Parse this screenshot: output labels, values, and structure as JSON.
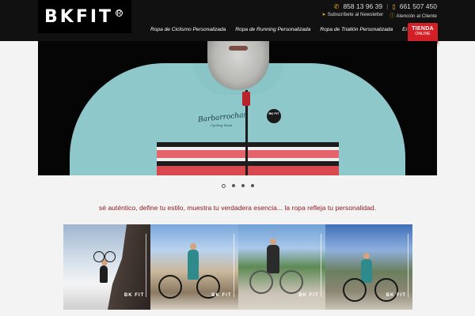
{
  "brand": {
    "logo": "BKFIT",
    "reg": "R"
  },
  "contact": {
    "phone1": "858 13 96 39",
    "phone2": "661 507 450"
  },
  "sub_links": [
    {
      "label": "Subscríbete al Newsletter",
      "icon": "paper-plane-icon"
    },
    {
      "label": "Atención al Cliente",
      "icon": "info-icon"
    }
  ],
  "nav": [
    "Ropa de Ciclismo Personalizada",
    "Ropa de Running Personalizada",
    "Ropa de Triatlón Personalizada",
    "Empresa"
  ],
  "shop_button": {
    "line1": "TIENDA",
    "line2": "ONLINE"
  },
  "hero": {
    "jersey_script": "Barbarrochas",
    "jersey_sub": "Cycling Team",
    "badge": "BK FIT"
  },
  "carousel": {
    "slides": 4,
    "active": 1
  },
  "tagline": "sé auténtico, define tu estilo, muestra tu verdadera esencia... la ropa refleja tu personalidad.",
  "tiles_mark": "BK FIT",
  "colors": {
    "header_bg": "#111111",
    "accent_red": "#d32027",
    "tagline": "#8b1e22",
    "jersey": "#8ec8cb"
  }
}
